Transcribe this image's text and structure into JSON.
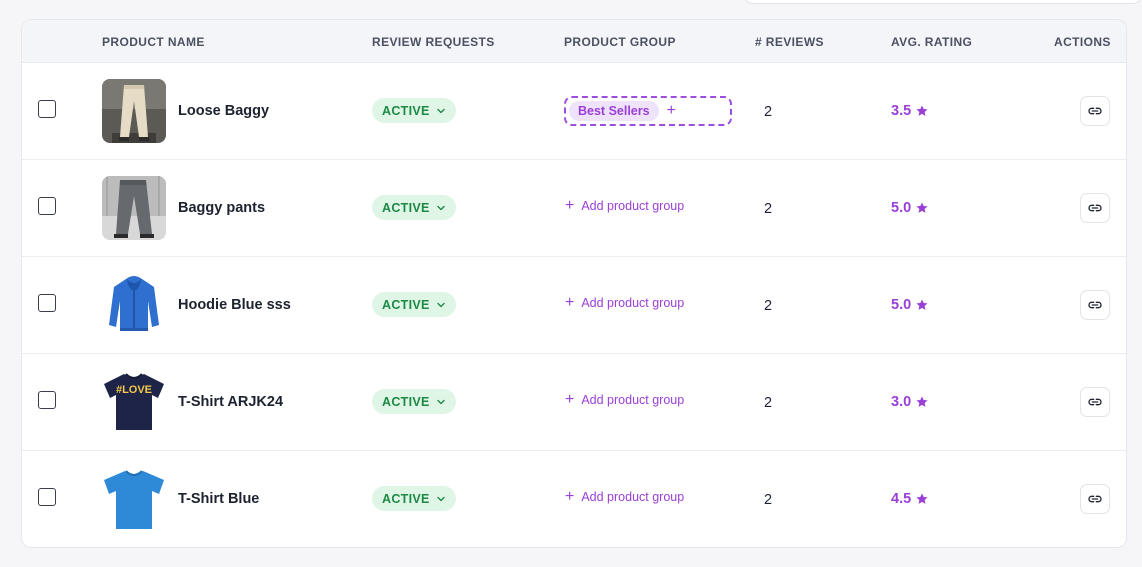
{
  "table": {
    "headers": {
      "product_name": "PRODUCT NAME",
      "review_requests": "REVIEW REQUESTS",
      "product_group": "PRODUCT GROUP",
      "reviews": "# REVIEWS",
      "avg_rating": "AVG. RATING",
      "actions": "ACTIONS"
    },
    "rows": [
      {
        "name": "Loose Baggy",
        "status": "ACTIVE",
        "group": "Best Sellers",
        "group_add": "",
        "reviews": "2",
        "rating": "3.5",
        "image": "beige-pants"
      },
      {
        "name": "Baggy pants",
        "status": "ACTIVE",
        "group": "",
        "group_add": "Add product group",
        "reviews": "2",
        "rating": "5.0",
        "image": "grey-pants"
      },
      {
        "name": "Hoodie Blue sss",
        "status": "ACTIVE",
        "group": "",
        "group_add": "Add product group",
        "reviews": "2",
        "rating": "5.0",
        "image": "blue-hoodie"
      },
      {
        "name": "T-Shirt ARJK24",
        "status": "ACTIVE",
        "group": "",
        "group_add": "Add product group",
        "reviews": "2",
        "rating": "3.0",
        "image": "love-tshirt",
        "image_text": "#LOVE"
      },
      {
        "name": "T-Shirt Blue",
        "status": "ACTIVE",
        "group": "",
        "group_add": "Add product group",
        "reviews": "2",
        "rating": "4.5",
        "image": "blue-tshirt"
      }
    ]
  },
  "colors": {
    "accent_purple": "#9b40d6",
    "status_green_bg": "#dff5e6",
    "status_green_text": "#1c8a45"
  },
  "icons": {
    "status_chevron": "chevron-down-icon",
    "rating": "star-icon",
    "group_add": "plus-icon",
    "action": "link-icon"
  }
}
